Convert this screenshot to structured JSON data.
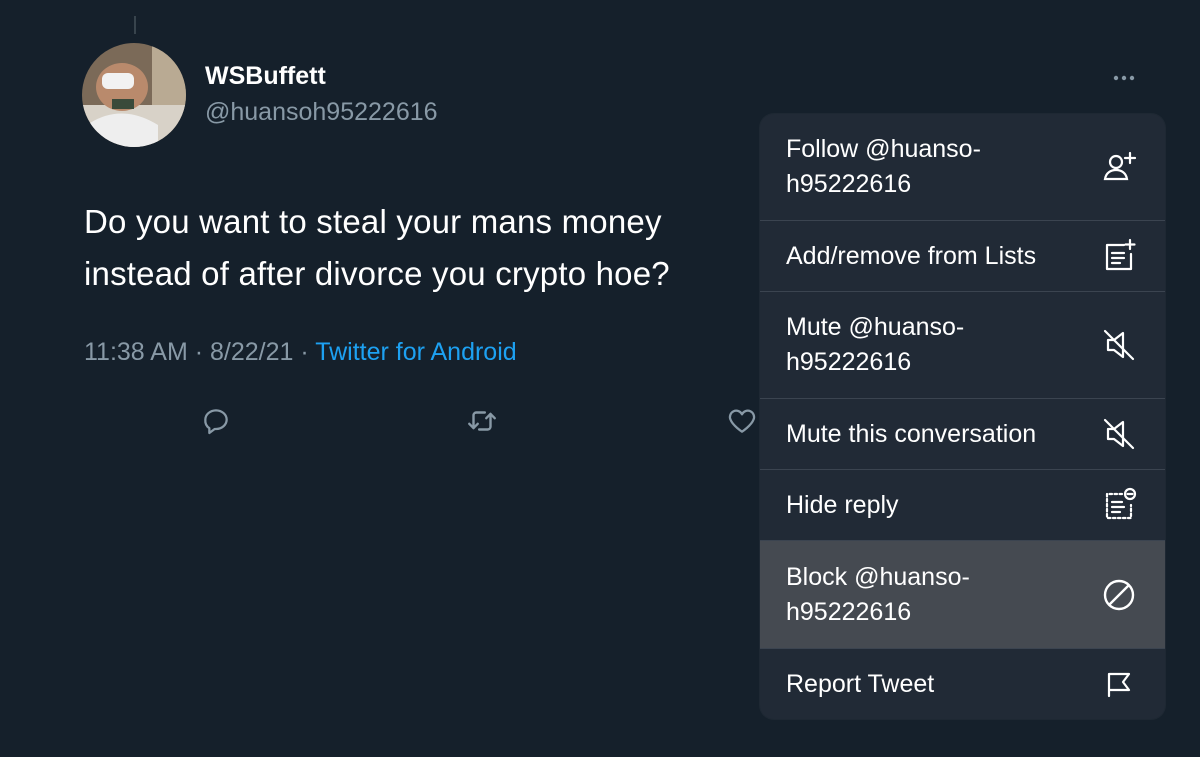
{
  "tweet": {
    "display_name": "WSBuffett",
    "handle": "@huansoh95222616",
    "text": "Do you want to steal your mans money\ninstead of after divorce you crypto hoe?",
    "time": "11:38 AM",
    "separator": " · ",
    "date": "8/22/21",
    "source": "Twitter for Android",
    "avatar_icon": "user-avatar-photo",
    "more_icon": "more-horizontal-icon"
  },
  "actions": [
    {
      "name": "reply",
      "icon": "reply-icon"
    },
    {
      "name": "retweet",
      "icon": "retweet-icon"
    },
    {
      "name": "like",
      "icon": "heart-icon"
    }
  ],
  "menu": {
    "items": [
      {
        "label": "Follow @huanso-\nh95222616",
        "icon": "follow-user-icon"
      },
      {
        "label": "Add/remove from Lists",
        "icon": "add-to-list-icon"
      },
      {
        "label": "Mute @huanso-\nh95222616",
        "icon": "mute-icon"
      },
      {
        "label": "Mute this conversation",
        "icon": "mute-icon"
      },
      {
        "label": "Hide reply",
        "icon": "hide-reply-icon"
      },
      {
        "label": "Block @huanso-\nh95222616",
        "icon": "block-icon"
      },
      {
        "label": "Report Tweet",
        "icon": "flag-icon"
      }
    ]
  },
  "colors": {
    "background": "#15202b",
    "menu_background": "#212a36",
    "menu_highlight": "#454a51",
    "secondary_text": "#8899a6",
    "link": "#1da1f2"
  }
}
